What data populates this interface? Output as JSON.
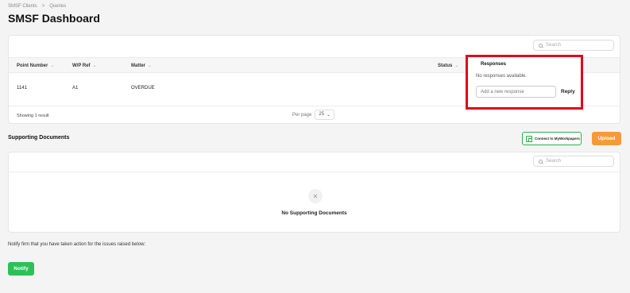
{
  "breadcrumb": {
    "items": [
      "SMSF Clients",
      ">",
      "Queries"
    ]
  },
  "page": {
    "title": "SMSF Dashboard"
  },
  "queries": {
    "search_placeholder": "Search",
    "columns": {
      "point_number": "Point Number",
      "wp_ref": "W/P Ref",
      "matter": "Matter",
      "status": "Status",
      "responses": "Responses"
    },
    "rows": [
      {
        "point_number": "1141",
        "wp_ref": "A1",
        "matter": "OVERDUE"
      }
    ],
    "showing": "Showing 1 result",
    "per_page_label": "Per page",
    "per_page_value": "25"
  },
  "responses_panel": {
    "header": "Responses",
    "empty_text": "No responses available.",
    "input_placeholder": "Add a new response",
    "reply_label": "Reply",
    "highlight_color": "#e0001a"
  },
  "supporting_documents": {
    "title": "Supporting Documents",
    "connect_label": "Connect to MyWorkpapers",
    "upload_label": "Upload",
    "search_placeholder": "Search",
    "empty_text": "No Supporting Documents"
  },
  "notify": {
    "text": "Notify firm that you have taken action for the issues raised below:",
    "button_label": "Notify"
  },
  "colors": {
    "upload": "#f59a3a",
    "notify": "#2fbf57",
    "connect_border": "#2eae4a"
  }
}
